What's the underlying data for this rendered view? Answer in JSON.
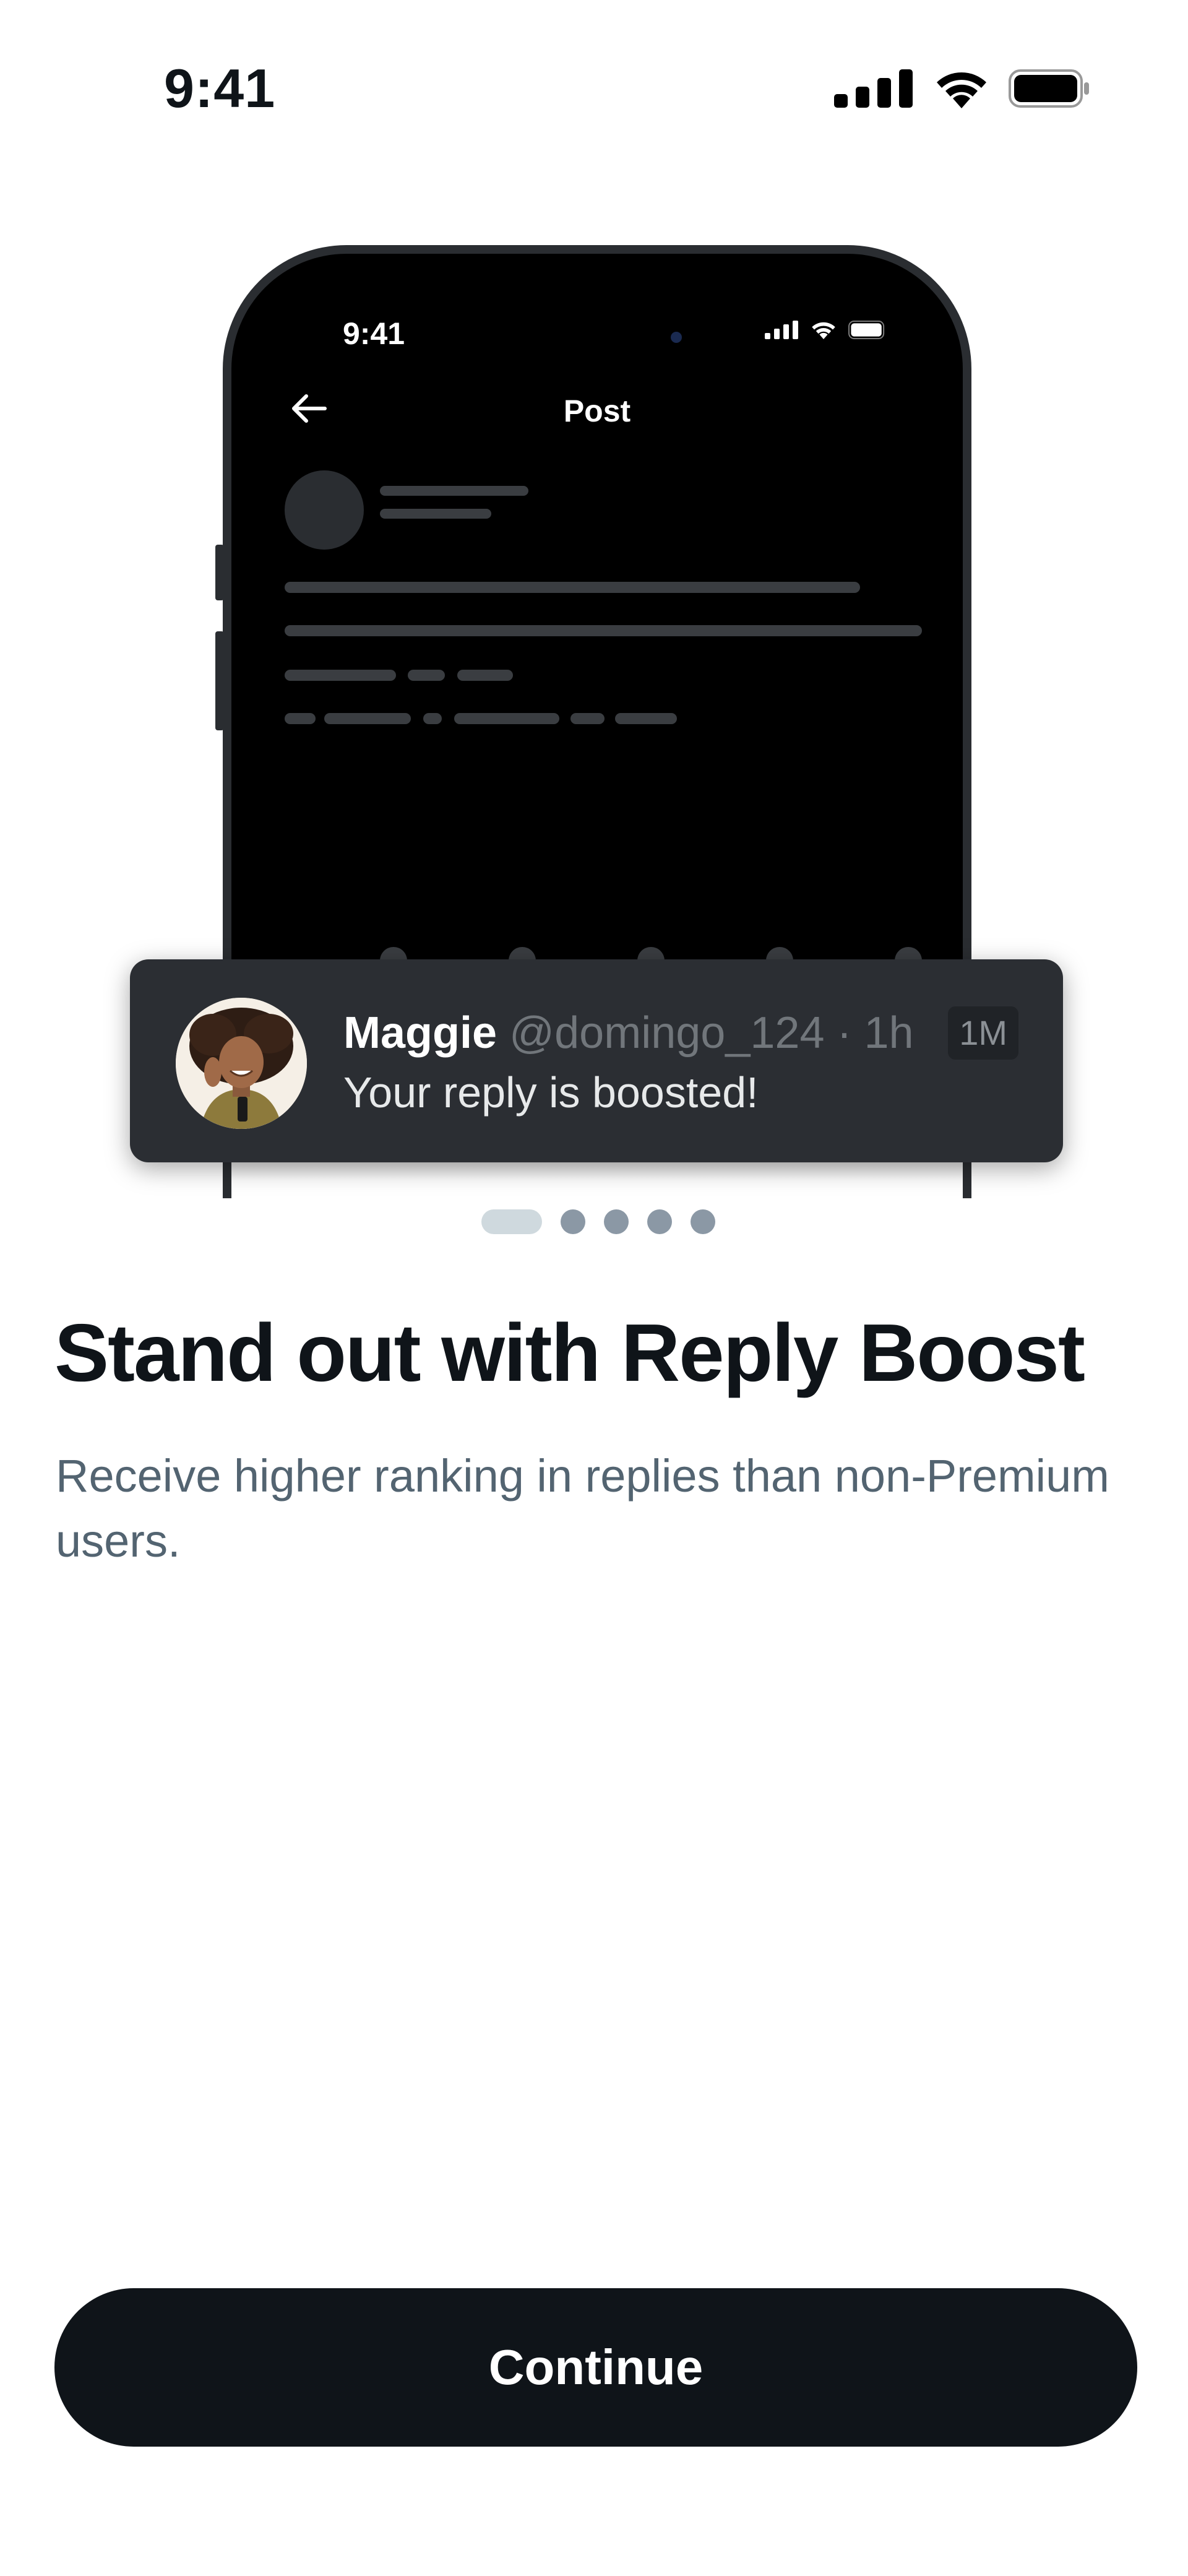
{
  "status_bar": {
    "time": "9:41",
    "icons": [
      "cellular-signal-icon",
      "wifi-icon",
      "battery-icon"
    ]
  },
  "phone_preview": {
    "time": "9:41",
    "title": "Post",
    "icons": [
      "back-arrow-icon",
      "cellular-signal-icon",
      "wifi-icon",
      "battery-icon"
    ]
  },
  "notification": {
    "name": "Maggie",
    "handle": "@domingo_124 · 1h",
    "text": "Your reply is boosted!",
    "badge": "1M"
  },
  "pager": {
    "total_pages": 5,
    "current_page": 1
  },
  "headline": "Stand out with Reply Boost",
  "description": "Receive higher ranking in replies than non-Premium users.",
  "continue_label": "Continue",
  "colors": {
    "primary_text": "#0f1419",
    "secondary_text": "#536471",
    "button_bg": "#0f1419",
    "card_bg": "#2b2e33",
    "background": "#ffffff"
  }
}
